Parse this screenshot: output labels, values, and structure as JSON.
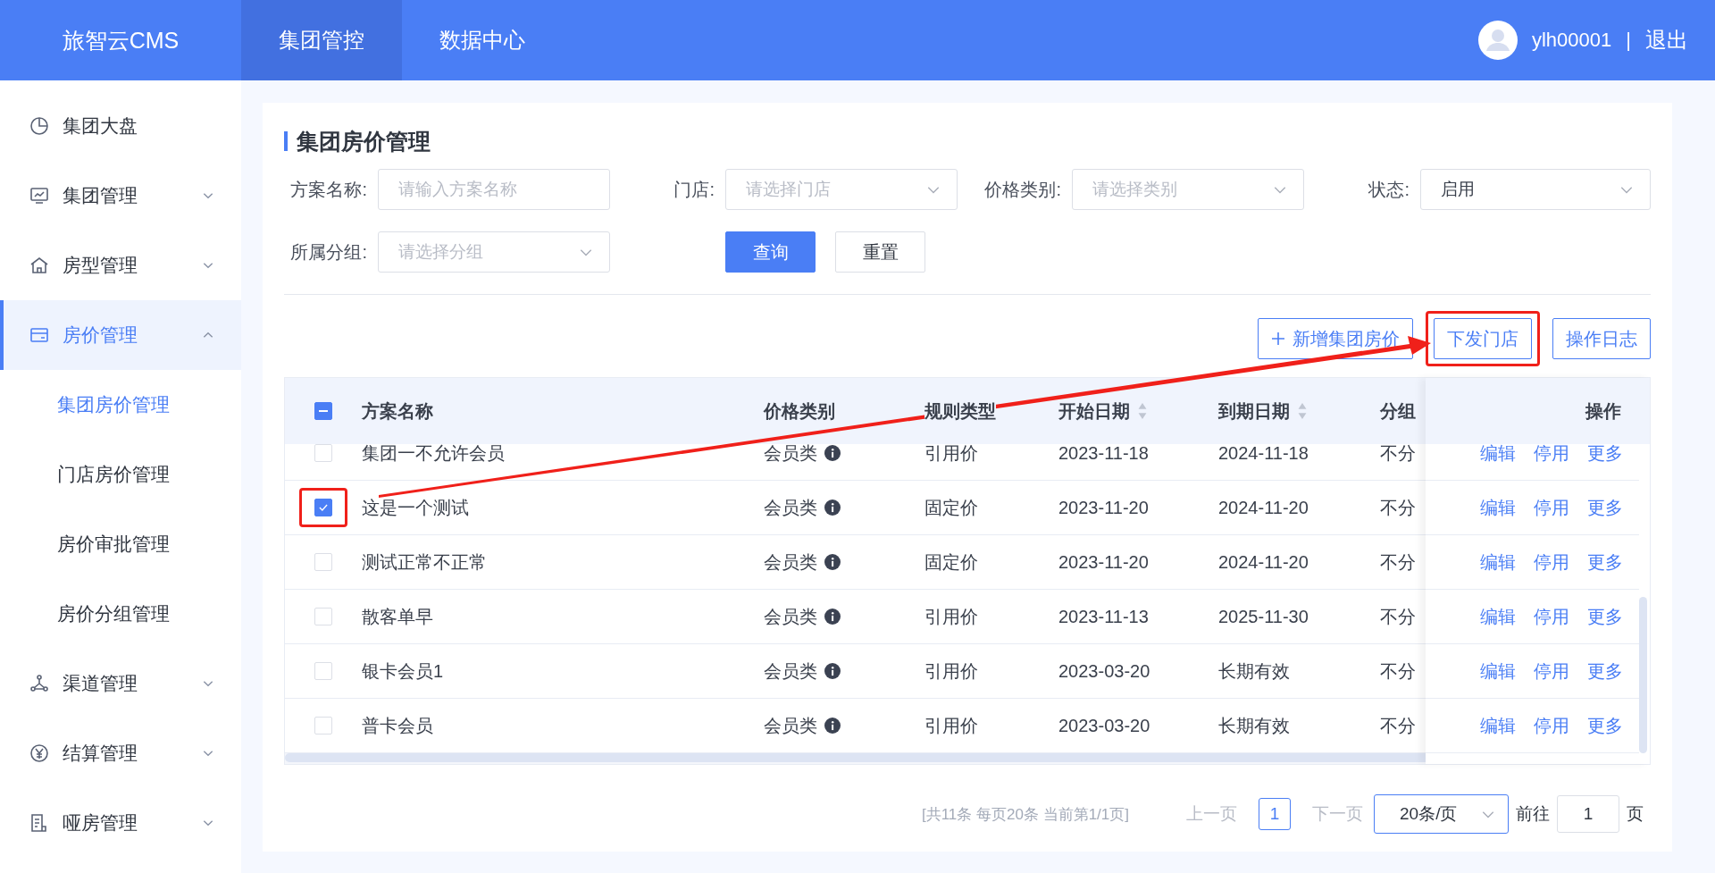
{
  "header": {
    "logo": "旅智云CMS",
    "nav": [
      {
        "label": "集团管控",
        "selected": true
      },
      {
        "label": "数据中心",
        "selected": false
      }
    ],
    "user": "ylh00001",
    "separator": "|",
    "logout": "退出"
  },
  "sidebar": {
    "items": [
      {
        "label": "集团大盘",
        "kind": "link",
        "selected": false
      },
      {
        "label": "集团管理",
        "kind": "group",
        "expanded": false,
        "selected": false
      },
      {
        "label": "房型管理",
        "kind": "group",
        "expanded": false,
        "selected": false
      },
      {
        "label": "房价管理",
        "kind": "group",
        "expanded": true,
        "selected": true,
        "children": [
          {
            "label": "集团房价管理",
            "selected": true
          },
          {
            "label": "门店房价管理",
            "selected": false
          },
          {
            "label": "房价审批管理",
            "selected": false
          },
          {
            "label": "房价分组管理",
            "selected": false
          }
        ]
      },
      {
        "label": "渠道管理",
        "kind": "group",
        "expanded": false,
        "selected": false
      },
      {
        "label": "结算管理",
        "kind": "group",
        "expanded": false,
        "selected": false
      },
      {
        "label": "哑房管理",
        "kind": "group",
        "expanded": false,
        "selected": false
      }
    ]
  },
  "page_title": "集团房价管理",
  "filters": [
    {
      "label": "方案名称:",
      "kind": "input",
      "placeholder": "请输入方案名称"
    },
    {
      "label": "门店:",
      "kind": "select",
      "placeholder": "请选择门店"
    },
    {
      "label": "价格类别:",
      "kind": "select",
      "placeholder": "请选择类别"
    },
    {
      "label": "状态:",
      "kind": "select",
      "value": "启用"
    },
    {
      "label": "所属分组:",
      "kind": "select",
      "placeholder": "请选择分组"
    }
  ],
  "query_button": "查询",
  "reset_button": "重置",
  "toolbar": [
    {
      "label": "新增集团房价",
      "kind": "add",
      "annotated": false
    },
    {
      "label": "下发门店",
      "kind": "plain",
      "annotated": true
    },
    {
      "label": "操作日志",
      "kind": "plain",
      "annotated": false
    }
  ],
  "table": {
    "select_all_partial": true,
    "columns": [
      {
        "label": "方案名称",
        "kind": "plain"
      },
      {
        "label": "价格类别",
        "kind": "plain"
      },
      {
        "label": "规则类型",
        "kind": "plain"
      },
      {
        "label": "开始日期",
        "kind": "sortable"
      },
      {
        "label": "到期日期",
        "kind": "sortable"
      },
      {
        "label": "分组",
        "kind": "plain"
      }
    ],
    "actions_header": "操作",
    "rows": [
      {
        "name": "集团一不允许会员",
        "price_type": "会员类",
        "rule_type": "引用价",
        "start": "2023-11-18",
        "end": "2024-11-18",
        "group": "不分",
        "checked": false,
        "annotated": false,
        "actions": [
          "编辑",
          "停用",
          "更多"
        ]
      },
      {
        "name": "这是一个测试",
        "price_type": "会员类",
        "rule_type": "固定价",
        "start": "2023-11-20",
        "end": "2024-11-20",
        "group": "不分",
        "checked": true,
        "annotated": true,
        "actions": [
          "编辑",
          "停用",
          "更多"
        ]
      },
      {
        "name": "测试正常不正常",
        "price_type": "会员类",
        "rule_type": "固定价",
        "start": "2023-11-20",
        "end": "2024-11-20",
        "group": "不分",
        "checked": false,
        "annotated": false,
        "actions": [
          "编辑",
          "停用",
          "更多"
        ]
      },
      {
        "name": "散客单早",
        "price_type": "会员类",
        "rule_type": "引用价",
        "start": "2023-11-13",
        "end": "2025-11-30",
        "group": "不分",
        "checked": false,
        "annotated": false,
        "actions": [
          "编辑",
          "停用",
          "更多"
        ]
      },
      {
        "name": "银卡会员1",
        "price_type": "会员类",
        "rule_type": "引用价",
        "start": "2023-03-20",
        "end": "长期有效",
        "group": "不分",
        "checked": false,
        "annotated": false,
        "actions": [
          "编辑",
          "停用",
          "更多"
        ]
      },
      {
        "name": "普卡会员",
        "price_type": "会员类",
        "rule_type": "引用价",
        "start": "2023-03-20",
        "end": "长期有效",
        "group": "不分",
        "checked": false,
        "annotated": false,
        "actions": [
          "编辑",
          "停用",
          "更多"
        ]
      }
    ]
  },
  "pagination": {
    "summary": "[共11条 每页20条 当前第1/1页]",
    "prev": "上一页",
    "pages": [
      {
        "label": "1",
        "selected": true
      }
    ],
    "next": "下一页",
    "page_size": "20条/页",
    "goto_label": "前往",
    "goto_value": "1",
    "goto_suffix": "页"
  }
}
